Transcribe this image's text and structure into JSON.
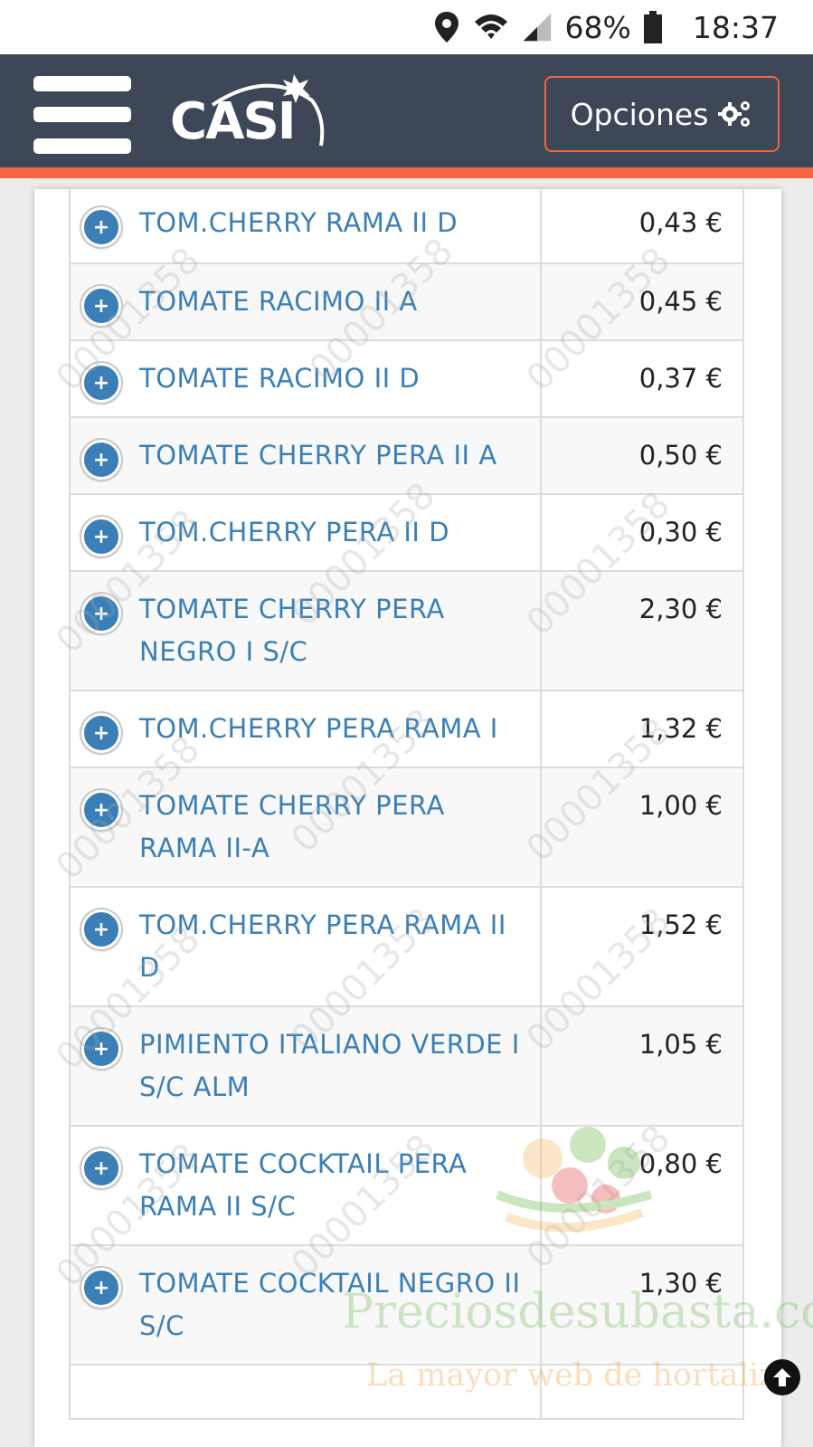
{
  "status_bar": {
    "battery": "68%",
    "time": "18:37",
    "icons": [
      "location-icon",
      "wifi-icon",
      "signal-icon",
      "battery-icon"
    ]
  },
  "header": {
    "logo_text": "CASI",
    "options_label": "Opciones",
    "options_icon": "gears-icon",
    "colors": {
      "bar": "#3e4758",
      "accent": "#f2673d"
    }
  },
  "products": [
    {
      "name": "TOM.CHERRY RAMA II D",
      "price": "0,43 €"
    },
    {
      "name": "TOMATE RACIMO II A",
      "price": "0,45 €"
    },
    {
      "name": "TOMATE RACIMO II D",
      "price": "0,37 €"
    },
    {
      "name": "TOMATE CHERRY PERA II A",
      "price": "0,50 €"
    },
    {
      "name": "TOM.CHERRY PERA II D",
      "price": "0,30 €"
    },
    {
      "name": "TOMATE CHERRY PERA NEGRO I S/C",
      "price": "2,30 €"
    },
    {
      "name": "TOM.CHERRY PERA RAMA I",
      "price": "1,32 €"
    },
    {
      "name": "TOMATE CHERRY PERA RAMA II-A",
      "price": "1,00 €"
    },
    {
      "name": "TOM.CHERRY PERA RAMA II D",
      "price": "1,52 €"
    },
    {
      "name": "PIMIENTO ITALIANO VERDE I S/C ALM",
      "price": "1,05 €"
    },
    {
      "name": "TOMATE COCKTAIL PERA RAMA II S/C",
      "price": "0,80 €"
    },
    {
      "name": "TOMATE COCKTAIL NEGRO II S/C",
      "price": "1,30 €"
    }
  ],
  "watermark": {
    "site": "Preciosdesubasta.com",
    "tagline": "La mayor web de hortaliza",
    "number": "00001358"
  }
}
